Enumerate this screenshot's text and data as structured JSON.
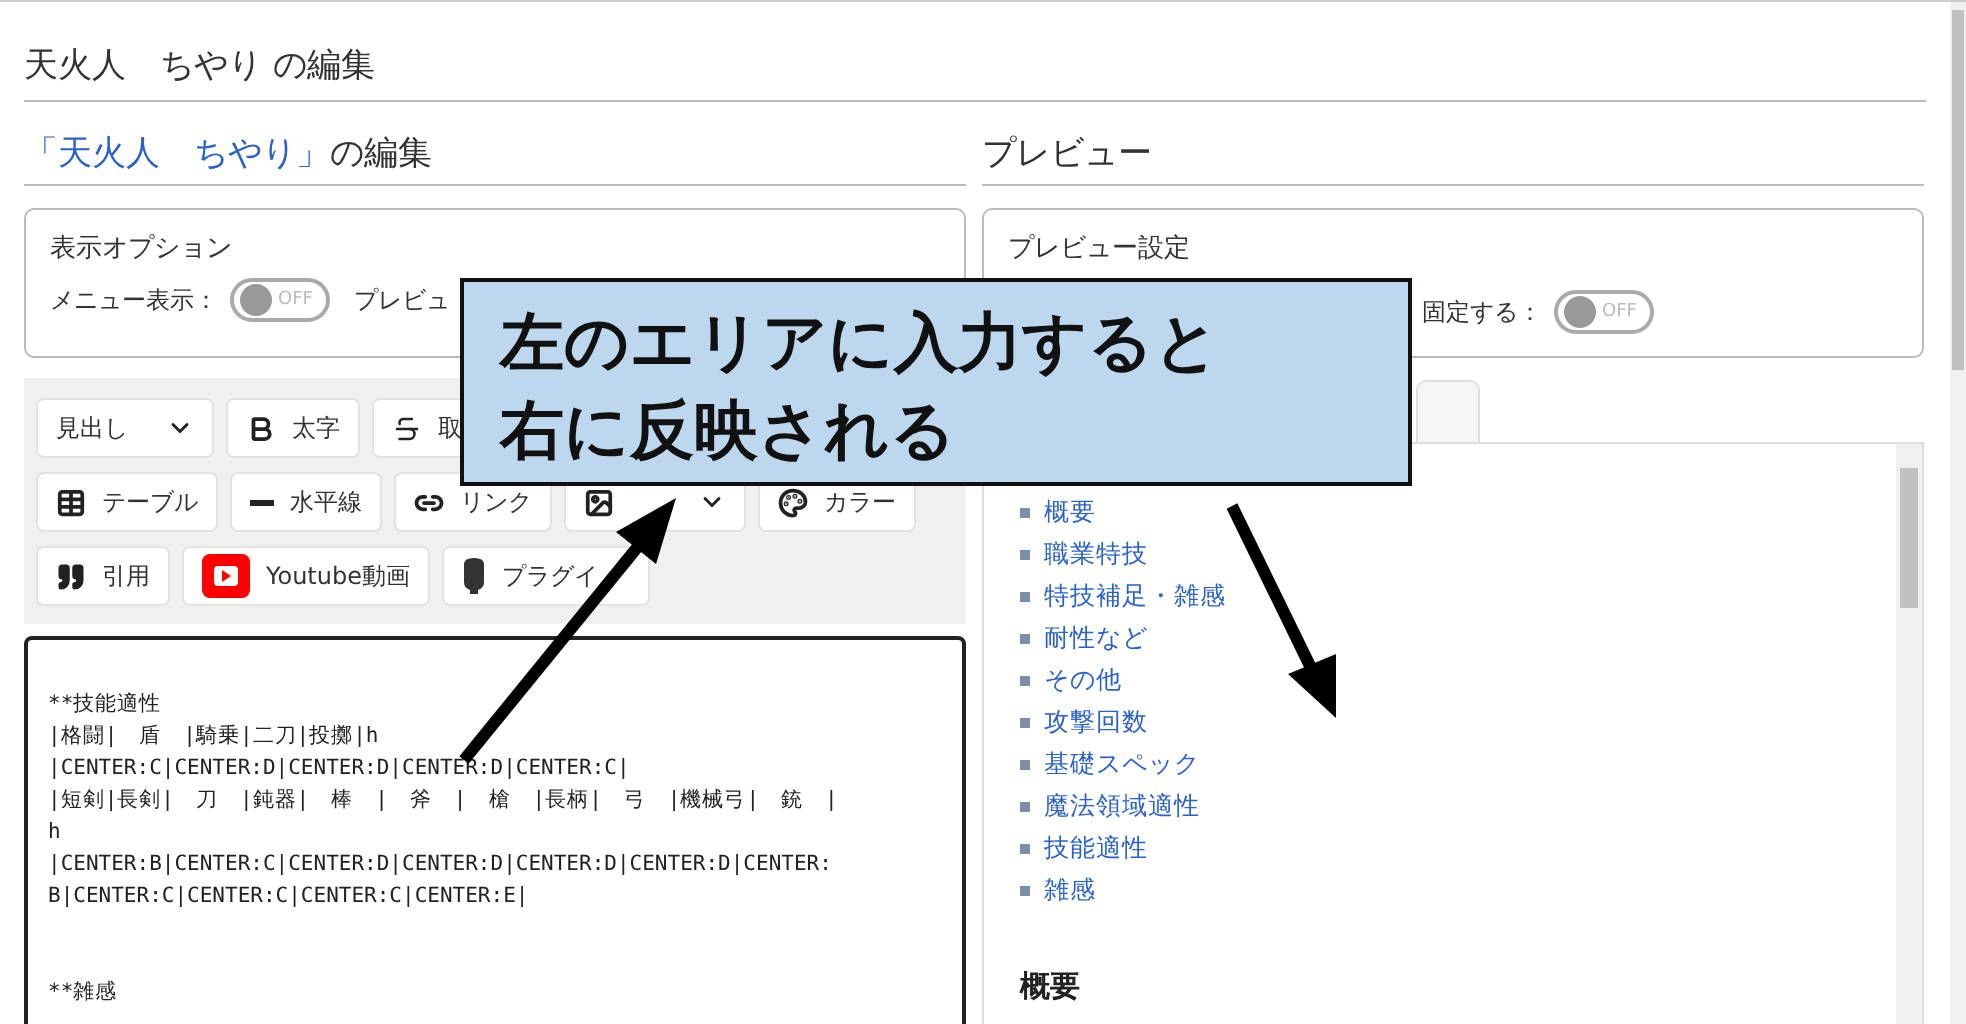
{
  "page_title": "天火人　ちやり の編集",
  "left": {
    "heading": {
      "link": "「天火人　ちやり」",
      "rest": "の編集"
    },
    "options": {
      "title": "表示オプション",
      "items": [
        {
          "kind": "toggle",
          "label": "メニュー表示：",
          "on": false,
          "state": "OFF"
        },
        {
          "kind": "text",
          "label": "プレビュ"
        }
      ]
    },
    "toolbar": [
      [
        {
          "label": "見出し",
          "kind": "heading",
          "dropdown": true
        },
        {
          "label": "太字",
          "kind": "bold",
          "dropdown": false
        },
        {
          "label": "取",
          "kind": "strike",
          "dropdown": false
        }
      ],
      [
        {
          "label": "テーブル",
          "kind": "table",
          "dropdown": false
        },
        {
          "label": "水平線",
          "kind": "rule",
          "dropdown": false
        },
        {
          "label": "リンク",
          "kind": "link",
          "dropdown": false
        },
        {
          "kind": "image",
          "dropdown": true
        },
        {
          "label": "カラー",
          "kind": "palette",
          "dropdown": false
        }
      ],
      [
        {
          "label": "引用",
          "kind": "quote",
          "dropdown": false
        },
        {
          "label": "Youtube動画",
          "kind": "video",
          "dropdown": false
        },
        {
          "label": "プラグイ",
          "kind": "plugin",
          "dropdown": false
        }
      ]
    ],
    "editor": "\n**技能適性\n|格闘|　盾　|騎乗|二刀|投擲|h\n|CENTER:C|CENTER:D|CENTER:D|CENTER:D|CENTER:C|\n|短剣|長剣|　刀　|鈍器|　棒　|　斧　|　槍　|長柄|　弓　|機械弓|　銃　|h\n|CENTER:B|CENTER:C|CENTER:D|CENTER:D|CENTER:D|CENTER:D|CENTER:B|CENTER:C|CENTER:C|CENTER:C|CENTER:E|\n\n\n**雑感"
  },
  "right": {
    "heading": "プレビュー",
    "settings": {
      "title": "プレビュー設定",
      "items": [
        {
          "kind": "toggle",
          "label": "固定する：",
          "on": false,
          "state": "OFF"
        }
      ]
    },
    "toc": [
      "概要",
      "職業特技",
      "特技補足・雑感",
      "耐性など",
      "その他",
      "攻撃回数",
      "基礎スペック",
      "魔法領域適性",
      "技能適性",
      "雑感"
    ],
    "section_heading": "概要"
  },
  "callout": [
    "左のエリアに入力すると",
    "右に反映される"
  ]
}
